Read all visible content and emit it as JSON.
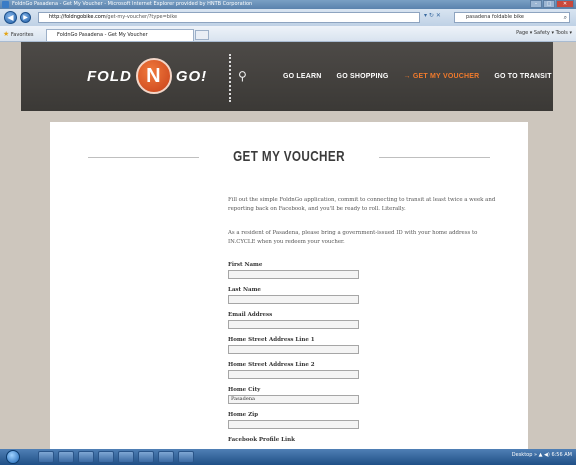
{
  "window": {
    "title": "FoldnGo Pasadena - Get My Voucher - Microsoft Internet Explorer provided by HNTB Corporation",
    "controls": [
      "–",
      "□",
      "✕"
    ]
  },
  "navbar": {
    "back": "◀",
    "forward": "▶",
    "address_host": "http://foldngobike.com",
    "address_path": "/get-my-voucher/?type=bike",
    "address_icons": "▾ ↻ ✕",
    "search_text": "pasadena foldable bike"
  },
  "favbar": {
    "favorites_label": "Favorites",
    "tab_title": "FoldnGo Pasadena - Get My Voucher",
    "command_bar": "Page ▾  Safety ▾  Tools ▾"
  },
  "site": {
    "logo_left": "FOLD",
    "logo_mid": "N",
    "logo_right": "GO!",
    "nav": [
      {
        "label": "GO LEARN"
      },
      {
        "label": "GO SHOPPING"
      },
      {
        "label": "→ GET MY VOUCHER"
      },
      {
        "label": "GO TO TRANSIT"
      }
    ],
    "page_title": "GET MY VOUCHER",
    "intro": "Fill out the simple FoldnGo application, commit to connecting to transit at least twice a week and reporting back on Facebook, and you'll be ready to roll. Literally.",
    "resident_note": "As a resident of Pasadena, please bring a government-issued ID with your home address to IN.CYCLE when you redeem your voucher."
  },
  "form": {
    "fields": [
      {
        "label": "First Name",
        "value": ""
      },
      {
        "label": "Last Name",
        "value": ""
      },
      {
        "label": "Email Address",
        "value": ""
      },
      {
        "label": "Home Street Address Line 1",
        "value": ""
      },
      {
        "label": "Home Street Address Line 2",
        "value": ""
      },
      {
        "label": "Home City",
        "value": "Pasadena"
      },
      {
        "label": "Home Zip",
        "value": ""
      },
      {
        "label": "Facebook Profile Link",
        "value": ""
      }
    ]
  },
  "taskbar": {
    "tray_text": "Desktop  »  ▲  ◀)  6:56 AM"
  }
}
